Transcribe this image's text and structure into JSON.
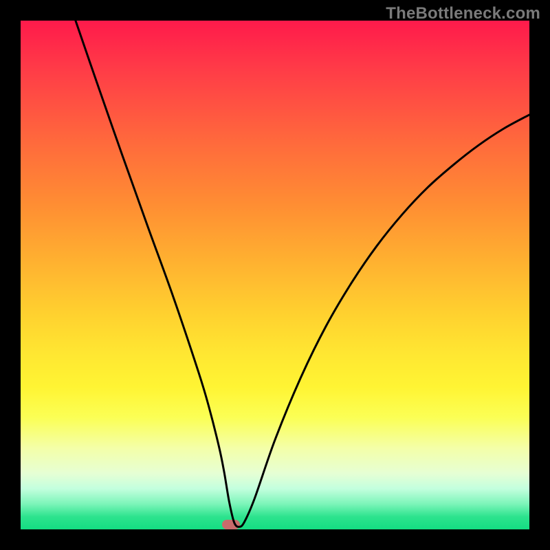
{
  "watermark": "TheBottleneck.com",
  "marker": {
    "x_pct": 41.3,
    "y_pct": 99.0
  },
  "chart_data": {
    "type": "line",
    "title": "",
    "xlabel": "",
    "ylabel": "",
    "xlim": [
      0,
      100
    ],
    "ylim": [
      0,
      100
    ],
    "grid": false,
    "series": [
      {
        "name": "bottleneck-curve",
        "x": [
          10.8,
          15,
          20,
          25,
          30,
          35,
          37,
          39,
          40,
          41,
          42,
          43,
          44,
          46,
          50,
          55,
          60,
          65,
          70,
          75,
          80,
          85,
          90,
          95,
          100
        ],
        "values": [
          100,
          87.8,
          73.5,
          59.5,
          45.7,
          30.8,
          24.1,
          16.2,
          11.3,
          5.4,
          1.3,
          0.5,
          1.5,
          6.1,
          17.6,
          29.7,
          39.9,
          48.4,
          55.7,
          61.9,
          67.2,
          71.6,
          75.5,
          78.8,
          81.5
        ]
      }
    ],
    "annotations": [
      {
        "name": "optimal-marker",
        "x": 41.3,
        "y": 1.0
      }
    ]
  }
}
